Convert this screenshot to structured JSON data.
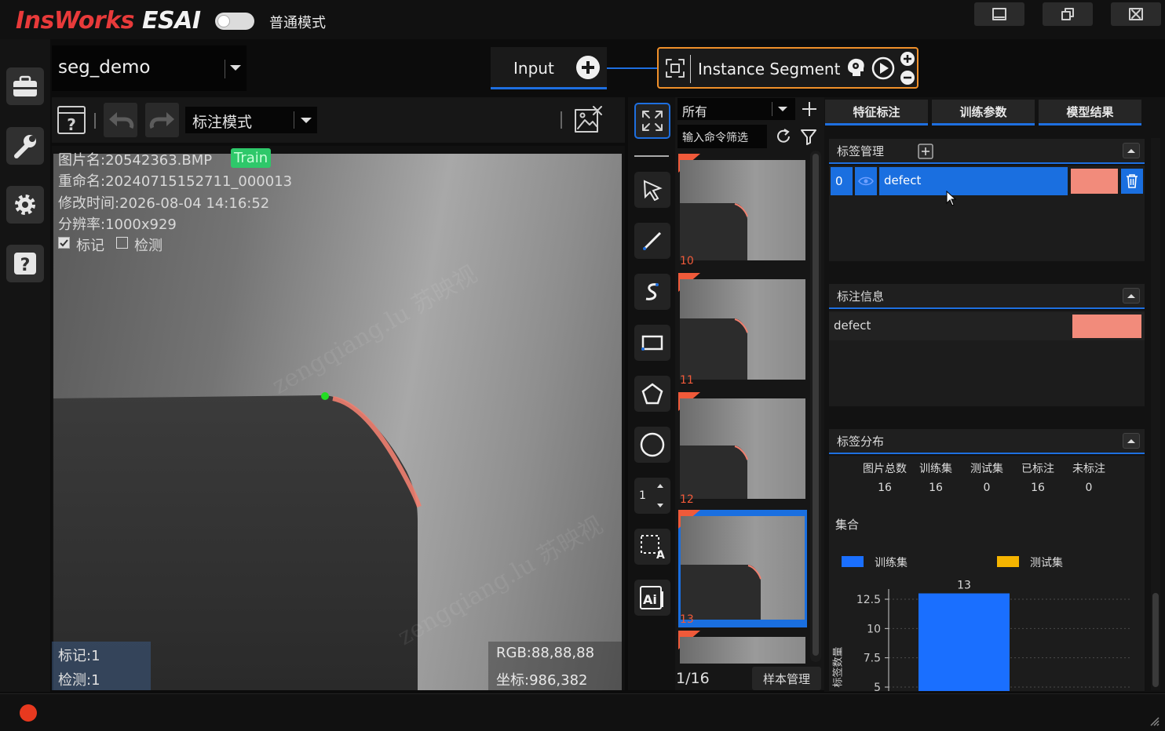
{
  "app": {
    "logo_red": "InsWorks",
    "logo_white": "ESAI",
    "mode_label": "普通模式"
  },
  "project": {
    "name": "seg_demo"
  },
  "pipeline": {
    "input_label": "Input",
    "node_label": "Instance Segment"
  },
  "canvas_toolbar": {
    "mode_select": "标注模式"
  },
  "image_info": {
    "filename": "图片名:20542363.BMP",
    "split_badge": "Train",
    "rename": "重命名:20240715152711_000013",
    "modified": "修改时间:2026-08-04 14:16:52",
    "resolution": "分辨率:1000x929",
    "chk_mark": "标记",
    "chk_detect": "检测",
    "mark_count": "标记:1",
    "detect_count": "检测:1",
    "rgb": "RGB:88,88,88",
    "coord": "坐标:986,382",
    "watermark": "zengqiang.lu 苏映视"
  },
  "tools": {
    "brush_size": "1"
  },
  "thumbs": {
    "filter_select": "所有",
    "cmd_placeholder": "输入命令筛选",
    "items": [
      "10",
      "11",
      "12",
      "13"
    ],
    "pager": "1/16",
    "manage_button": "样本管理"
  },
  "tabs": [
    "特征标注",
    "训练参数",
    "模型结果"
  ],
  "label_manager": {
    "title": "标签管理",
    "row": {
      "index": "0",
      "name": "defect",
      "color": "#f28b7b"
    }
  },
  "label_info": {
    "title": "标注信息",
    "row": {
      "name": "defect",
      "color": "#f28b7b"
    }
  },
  "label_dist": {
    "title": "标签分布",
    "headers": [
      "图片总数",
      "训练集",
      "测试集",
      "已标注",
      "未标注"
    ],
    "values": [
      "16",
      "16",
      "0",
      "16",
      "0"
    ],
    "set_label": "集合",
    "legend": [
      {
        "name": "训练集",
        "color": "#1a6fff"
      },
      {
        "name": "测试集",
        "color": "#f5b400"
      }
    ],
    "ylabel": "标签数量"
  },
  "chart_data": {
    "type": "bar",
    "categories": [
      ""
    ],
    "series": [
      {
        "name": "训练集",
        "values": [
          13
        ]
      },
      {
        "name": "测试集",
        "values": [
          0
        ]
      }
    ],
    "data_labels": [
      "13"
    ],
    "yticks": [
      "12.5",
      "10",
      "7.5",
      "5"
    ],
    "ylim": [
      0,
      14
    ],
    "ylabel": "标签数量",
    "grid": true,
    "colors": [
      "#1a6fff",
      "#f5b400"
    ]
  },
  "colors": {
    "brand": "#e83a3a",
    "accent": "#1e6fe0",
    "node_border": "#f0902a",
    "defect": "#f28b7b",
    "status_dot": "#e8391f"
  }
}
